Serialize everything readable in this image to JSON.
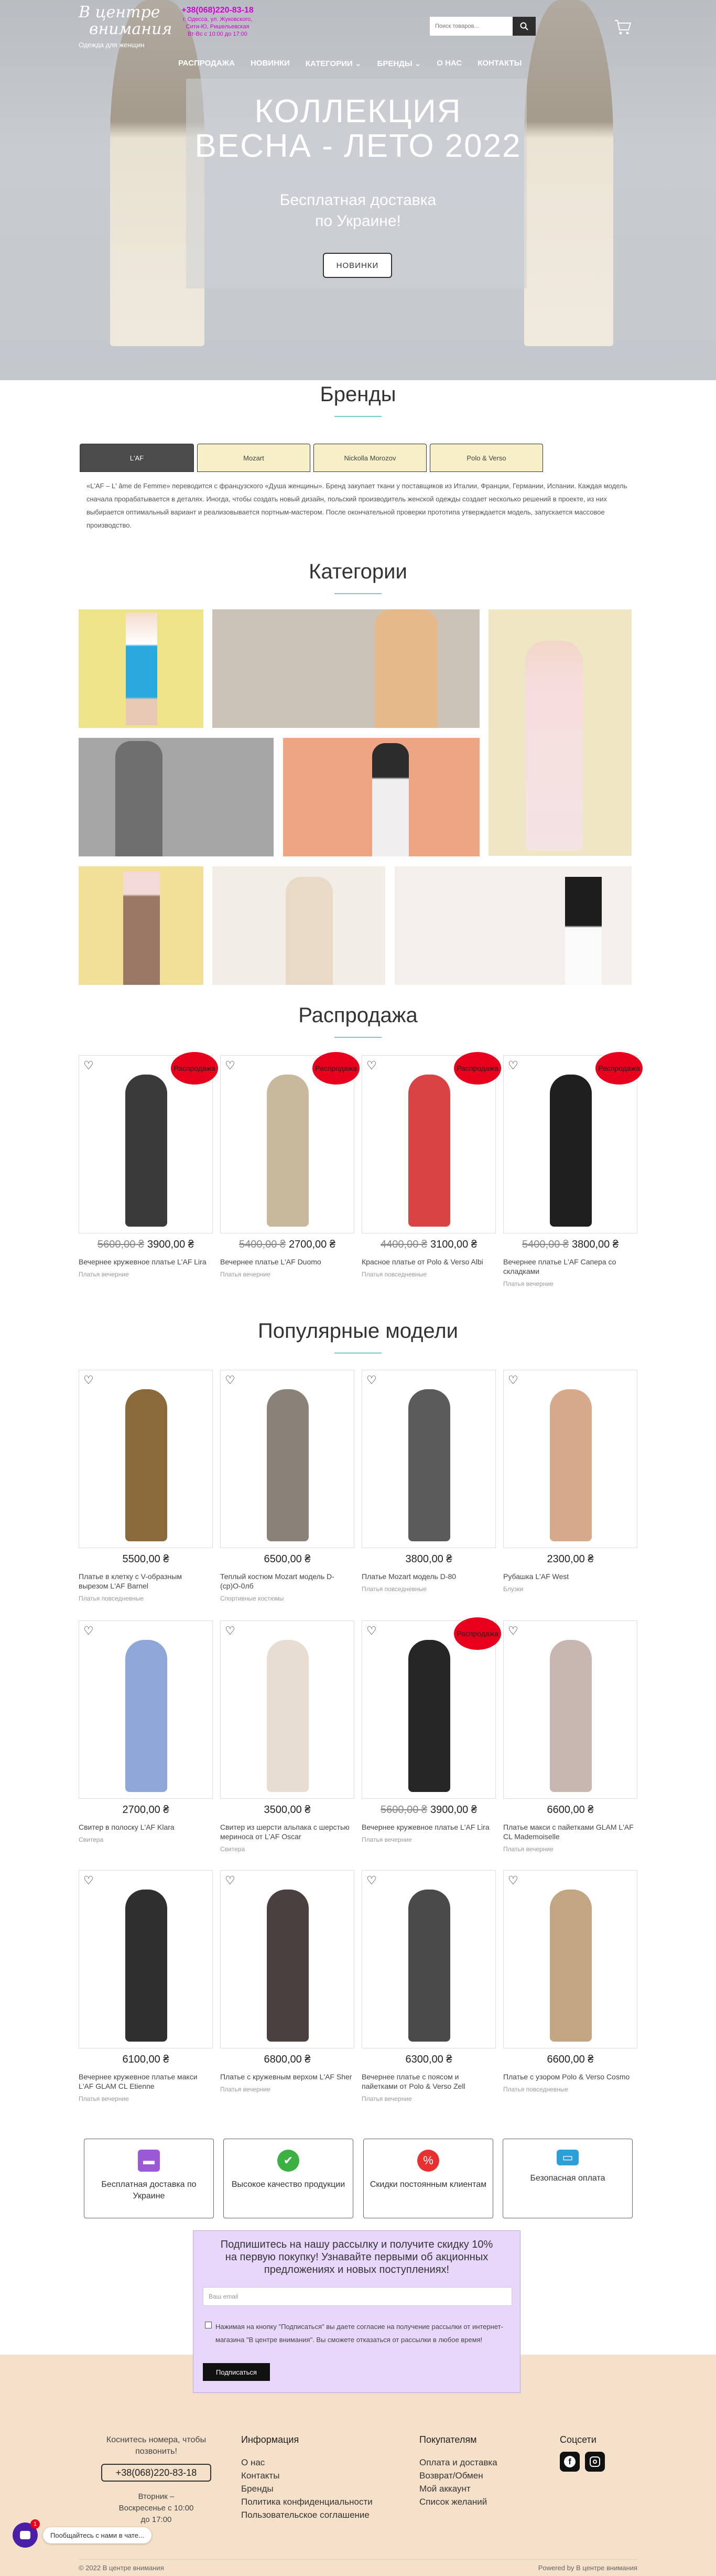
{
  "header": {
    "logo_line1": "В центре",
    "logo_line2": "внимания",
    "logo_tagline": "Одежда для женщин",
    "phone": "+38(068)220-83-18",
    "address_lines": [
      "г. Одесса, ул. Жуковского,",
      "Сити-Ю, Ришельевская",
      "Вт-Вс с 10:00 до 17:00"
    ],
    "search_placeholder": "Поиск товаров...",
    "nav": [
      "РАСПРОДАЖА",
      "НОВИНКИ",
      "КАТЕГОРИИ ⌄",
      "БРЕНДЫ ⌄",
      "О НАС",
      "КОНТАКТЫ"
    ]
  },
  "hero": {
    "title_line1": "КОЛЛЕКЦИЯ",
    "title_line2": "ВЕСНА - ЛЕТО 2022",
    "subtitle_line1": "Бесплатная доставка",
    "subtitle_line2": "по Украине!",
    "cta": "НОВИНКИ"
  },
  "brands": {
    "title": "Бренды",
    "tabs": [
      "L'AF",
      "Mozart",
      "Nickolla Morozov",
      "Polo & Verso"
    ],
    "active_tab": "L'AF",
    "text": "«L'AF – L' âme de Femme» переводится с французского «Душа женщины». Бренд закупает ткани у поставщиков из Италии, Франции, Германии, Испании. Каждая модель сначала прорабатывается в деталях. Иногда, чтобы создать новый дизайн, польский производитель женской одежды создает несколько решений в проекте, из них выбирается оптимальный вариант и реализовывается портным-мастером. После окончательной проверки прототипа утверждается модель, запускается массовое производство."
  },
  "categories": {
    "title": "Категории"
  },
  "sale": {
    "title": "Распродажа",
    "badge": "Распродажа",
    "products": [
      {
        "name": "Вечернее кружевное платье L'AF Lira",
        "old": "5600,00 ₴",
        "price": "3900,00 ₴",
        "cat": "Платья вечерние"
      },
      {
        "name": "Вечернее платье L'AF Duomo",
        "old": "5400,00 ₴",
        "price": "2700,00 ₴",
        "cat": "Платья вечерние"
      },
      {
        "name": "Красное платье от Polo & Verso Albi",
        "old": "4400,00 ₴",
        "price": "3100,00 ₴",
        "cat": "Платья повседневные"
      },
      {
        "name": "Вечернее платье L'AF Сапера со складками",
        "old": "5400,00 ₴",
        "price": "3800,00 ₴",
        "cat": "Платья вечерние"
      }
    ]
  },
  "popular": {
    "title": "Популярные модели",
    "rows": [
      [
        {
          "name": "Платье в клетку с V-образным вырезом L'AF Barnel",
          "old": "",
          "price": "5500,00 ₴",
          "cat": "Платья повседневные",
          "sale": false
        },
        {
          "name": "Теплый костюм Mozart модель D-(ср)O-0лб",
          "old": "",
          "price": "6500,00 ₴",
          "cat": "Спортивные костюмы",
          "sale": false
        },
        {
          "name": "Платье Mozart модель D-80",
          "old": "",
          "price": "3800,00 ₴",
          "cat": "Платья повседневные",
          "sale": false
        },
        {
          "name": "Рубашка L'AF West",
          "old": "",
          "price": "2300,00 ₴",
          "cat": "Блузки",
          "sale": false
        }
      ],
      [
        {
          "name": "Свитер в полоску L'AF Klara",
          "old": "",
          "price": "2700,00 ₴",
          "cat": "Свитера",
          "sale": false
        },
        {
          "name": "Свитер из шерсти альпака с шерстью мериноса от L'AF Oscar",
          "old": "",
          "price": "3500,00 ₴",
          "cat": "Свитера",
          "sale": false
        },
        {
          "name": "Вечернее кружевное платье L'AF Lira",
          "old": "5600,00 ₴",
          "price": "3900,00 ₴",
          "cat": "Платья вечерние",
          "sale": true
        },
        {
          "name": "Платье макси с пайетками GLAM L'AF CL Mademoiselle",
          "old": "",
          "price": "6600,00 ₴",
          "cat": "Платья вечерние",
          "sale": false
        }
      ],
      [
        {
          "name": "Вечернее кружевное платье макси L'AF GLAM CL Etienne",
          "old": "",
          "price": "6100,00 ₴",
          "cat": "Платья вечерние",
          "sale": false
        },
        {
          "name": "Платье с кружевным верхом L'AF Sher",
          "old": "",
          "price": "6800,00 ₴",
          "cat": "Платья вечерние",
          "sale": false
        },
        {
          "name": "Вечернее платье с поясом и пайетками от Polo & Verso Zell",
          "old": "",
          "price": "6300,00 ₴",
          "cat": "Платья вечерние",
          "sale": false
        },
        {
          "name": "Платье с узором Polo & Verso Cosmo",
          "old": "",
          "price": "6600,00 ₴",
          "cat": "Платья повседневные",
          "sale": false
        }
      ]
    ]
  },
  "features": [
    {
      "text": "Бесплатная доставка по Украине",
      "icon": "truck-icon",
      "color": "#9b59d6"
    },
    {
      "text": "Высокое качество продукции",
      "icon": "thumbs-up-icon",
      "color": "#3cb043"
    },
    {
      "text": "Скидки постоянным клиентам",
      "icon": "percent-icon",
      "color": "#e83030"
    },
    {
      "text": "Безопасная оплата",
      "icon": "card-icon",
      "color": "#2a9fd8"
    }
  ],
  "newsletter": {
    "title": "Подпишитесь на нашу рассылку и получите скидку 10% на первую покупку! Узнавайте первыми об акционных предложениях и новых поступлениях!",
    "email_placeholder": "Ваш email",
    "agree": "Нажимая на кнопку \"Подписаться\" вы даете согласие на получение рассылки от интернет-магазина \"В центре внимания\". Вы сможете отказаться от рассылки в любое время!",
    "button": "Подписаться"
  },
  "footer": {
    "call_text": "Коснитесь номера, чтобы позвонить!",
    "phone": "+38(068)220-83-18",
    "hours": "Вторник – Воскресенье с 10:00 до 17:00",
    "info_title": "Информация",
    "info_links": [
      "О нас",
      "Контакты",
      "Бренды",
      "Политика конфиденциальности",
      "Пользовательское соглашение"
    ],
    "buyers_title": "Покупателям",
    "buyers_links": [
      "Оплата и доставка",
      "Возврат/Обмен",
      "Мой аккаунт",
      "Список желаний"
    ],
    "social_title": "Соцсети",
    "copyright": "© 2022 В центре внимания",
    "powered": "Powered by В центре внимания"
  },
  "chat": {
    "text": "Пообщайтесь с нами в чате...",
    "badge": "1"
  },
  "colors": {
    "accent": "#7cc",
    "sale_badge": "#e8001c",
    "footer_bg": "#f5e1c9",
    "newsletter_bg": "#e9d7fb",
    "tab_bg": "#f6efc7"
  }
}
